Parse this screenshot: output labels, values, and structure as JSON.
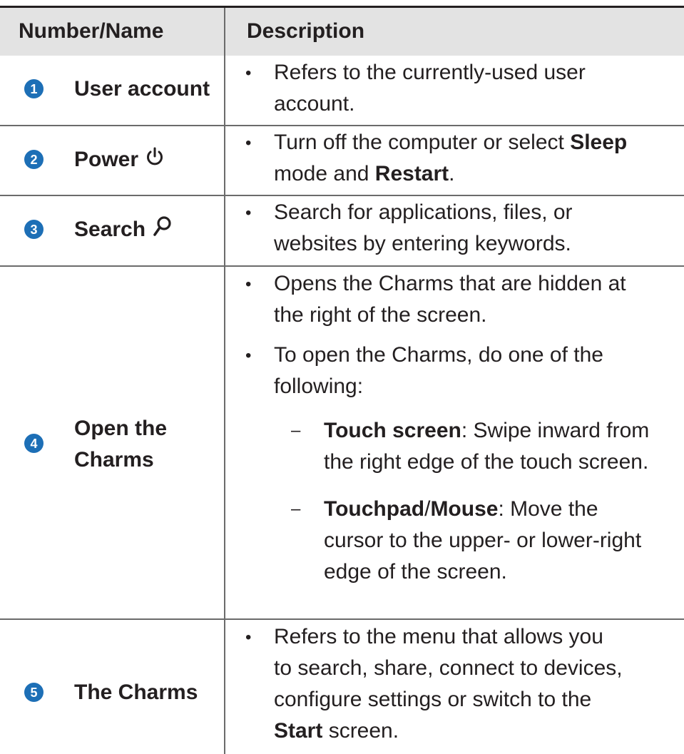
{
  "header": {
    "col1": "Number/Name",
    "col2": "Description"
  },
  "bullet_glyph": "•",
  "dash_glyph": "–",
  "rows": [
    {
      "number": "1",
      "name": "User account",
      "icon": "",
      "items": [
        {
          "lines": [
            "Refers to the currently-used user",
            "account."
          ]
        }
      ]
    },
    {
      "number": "2",
      "name": "Power",
      "icon": "power-icon",
      "items": [
        {
          "line1_pre": "Turn off the computer or select ",
          "line1_bold": "Sleep",
          "line2_pre": "mode and ",
          "line2_bold": "Restart",
          "line2_post": "."
        }
      ]
    },
    {
      "number": "3",
      "name": "Search",
      "icon": "search-icon",
      "items": [
        {
          "lines": [
            "Search for applications, files, or",
            "websites by entering keywords."
          ]
        }
      ]
    },
    {
      "number": "4",
      "name_lines": [
        "Open the",
        "Charms"
      ],
      "icon": "",
      "items": [
        {
          "lines": [
            "Opens the Charms that are hidden at",
            "the right of the screen."
          ]
        },
        {
          "lines": [
            "To open the Charms, do one of the",
            "following:"
          ]
        }
      ],
      "subitems": [
        {
          "bold": "Touch screen",
          "line1_post": ": Swipe inward from",
          "line2": "the right edge of the touch screen."
        },
        {
          "bold1": "Touchpad",
          "sep": "/",
          "bold2": "Mouse",
          "line1_post": ": Move the",
          "line2": "cursor to the upper- or lower-right",
          "line3": "edge of the screen."
        }
      ]
    },
    {
      "number": "5",
      "name": "The Charms",
      "icon": "",
      "items": [
        {
          "line1": "Refers to the menu that allows you",
          "line2": "to search, share, connect to devices,",
          "line3": "configure settings or switch to the",
          "line4_bold": "Start",
          "line4_post": " screen."
        }
      ]
    }
  ]
}
